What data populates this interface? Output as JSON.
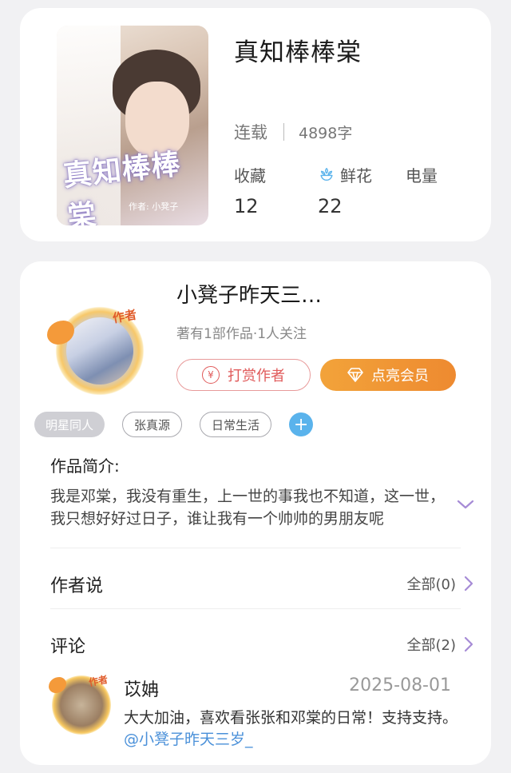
{
  "book": {
    "title": "真知棒棒棠",
    "cover_title": "真知棒棒棠",
    "cover_author": "作者: 小凳子",
    "status": "连载",
    "word_count": "4898字",
    "stats": [
      {
        "label": "收藏",
        "value": "12",
        "icon": "bookmark"
      },
      {
        "label": "鲜花",
        "value": "22",
        "icon": "flower-icon"
      },
      {
        "label": "电量",
        "value": "",
        "icon": "battery"
      }
    ]
  },
  "author": {
    "badge": "作者",
    "name": "小凳子昨天三…",
    "meta": "著有1部作品·1人关注",
    "reward_label": "打赏作者",
    "reward_icon": "¥",
    "vip_label": "点亮会员"
  },
  "tags": {
    "items": [
      "明星同人",
      "张真源",
      "日常生活"
    ],
    "active_index": 0,
    "add_icon": "+"
  },
  "intro": {
    "label": "作品简介:",
    "text": "我是邓棠，我没有重生，上一世的事我也不知道，这一世，我只想好好过日子，谁让我有一个帅帅的男朋友呢"
  },
  "author_says": {
    "title": "作者说",
    "link": "全部(0)"
  },
  "comments": {
    "title": "评论",
    "link": "全部(2)",
    "items": [
      {
        "badge": "作者",
        "user": "苡姌",
        "date": "2025-08-01",
        "body": "大大加油，喜欢看张张和邓棠的日常！支持支持。",
        "mention": "@小凳子昨天三岁_"
      }
    ]
  },
  "colors": {
    "accent_orange": "#ee8a30",
    "reward_red": "#e05a5a",
    "chevron_purple": "#a68bd6",
    "mention_blue": "#4a90d9",
    "tag_add_blue": "#5ab3ec"
  }
}
